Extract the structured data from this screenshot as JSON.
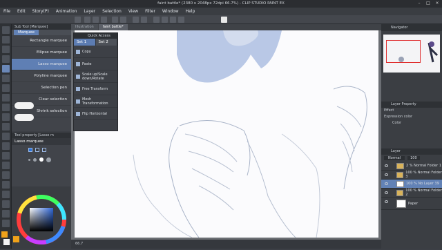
{
  "title": "faint battle* (2380 x 2048px 72dpi 66.7%)  - CLIP STUDIO PAINT EX",
  "menu": [
    "File",
    "Edit",
    "Story(P)",
    "Animation",
    "Layer",
    "Selection",
    "View",
    "Filter",
    "Window",
    "Help"
  ],
  "subtool": {
    "header": "Sub Tool [Marquee]",
    "tab": "Marquee",
    "items": [
      "Rectangle marquee",
      "Ellipse marquee",
      "Lasso marquee",
      "Polyline marquee",
      "Selection pen",
      "Clear selection",
      "Shrink selection"
    ],
    "selected_index": 2
  },
  "tool_property": {
    "header": "Tool property [Lasso m",
    "name": "Lasso marquee"
  },
  "document_tabs": [
    "Illustration",
    "faint battle*"
  ],
  "quick_access": {
    "header": "Quick Access",
    "tabs": [
      "Set 1",
      "Set 2"
    ],
    "items": [
      "Copy",
      "Paste",
      "Scale up/Scale down/Rotate",
      "Free Transform",
      "Mesh Transformation",
      "Flip Horizontal"
    ]
  },
  "navigator": {
    "label": "Navigator"
  },
  "layer_property": {
    "label": "Layer Property",
    "effect": "Effect",
    "expression_color": "Expression color",
    "color_value": "Color"
  },
  "layer_panel": {
    "label": "Layer",
    "blend_mode": "Normal",
    "opacity": "100",
    "layers": [
      {
        "name": "2 % Normal\nFolder 1",
        "type": "folder"
      },
      {
        "name": "100 % Normal\nFolder 3",
        "type": "folder"
      },
      {
        "name": "100 % No\nLayer 39",
        "type": "raster",
        "selected": true
      },
      {
        "name": "100 % Normal\nFolder 2",
        "type": "folder"
      },
      {
        "name": "Paper",
        "type": "paper"
      }
    ]
  },
  "status": "66.7",
  "colors": {
    "accent": "#6282b6",
    "sketch": "#b9c8e6",
    "canvas": "#fbfbfd"
  }
}
